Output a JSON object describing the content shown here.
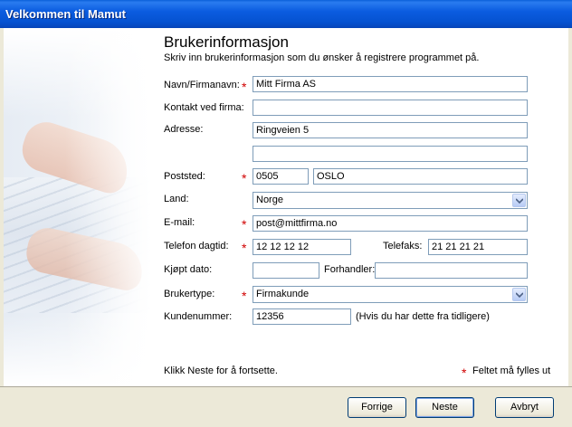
{
  "window": {
    "title": "Velkommen til Mamut"
  },
  "header": {
    "title": "Brukerinformasjon",
    "subtitle": "Skriv inn brukerinformasjon som du ønsker å registrere programmet på."
  },
  "form": {
    "name": {
      "label": "Navn/Firmanavn:",
      "value": "Mitt Firma AS",
      "required": true
    },
    "contact": {
      "label": "Kontakt ved firma:",
      "value": ""
    },
    "address": {
      "label": "Adresse:",
      "value1": "Ringveien 5",
      "value2": ""
    },
    "postal": {
      "label": "Poststed:",
      "code": "0505",
      "city": "OSLO",
      "required": true
    },
    "country": {
      "label": "Land:",
      "value": "Norge"
    },
    "email": {
      "label": "E-mail:",
      "value": "post@mittfirma.no",
      "required": true
    },
    "phone": {
      "label": "Telefon dagtid:",
      "value": "12 12 12 12",
      "required": true
    },
    "fax": {
      "label": "Telefaks:",
      "value": "21 21 21 21"
    },
    "purchase_date": {
      "label": "Kjøpt dato:",
      "value": ""
    },
    "dealer": {
      "label": "Forhandler:",
      "value": ""
    },
    "user_type": {
      "label": "Brukertype:",
      "value": "Firmakunde",
      "required": true
    },
    "customer_number": {
      "label": "Kundenummer:",
      "value": "12356",
      "hint": "(Hvis du har dette fra tidligere)"
    }
  },
  "footer": {
    "instruction": "Klikk Neste for å fortsette.",
    "required_note": "Feltet må fylles ut",
    "required_mark": "*"
  },
  "buttons": {
    "back": "Forrige",
    "next": "Neste",
    "cancel": "Avbryt"
  },
  "colors": {
    "required": "#d00000",
    "titlebar": "#0552d0"
  }
}
